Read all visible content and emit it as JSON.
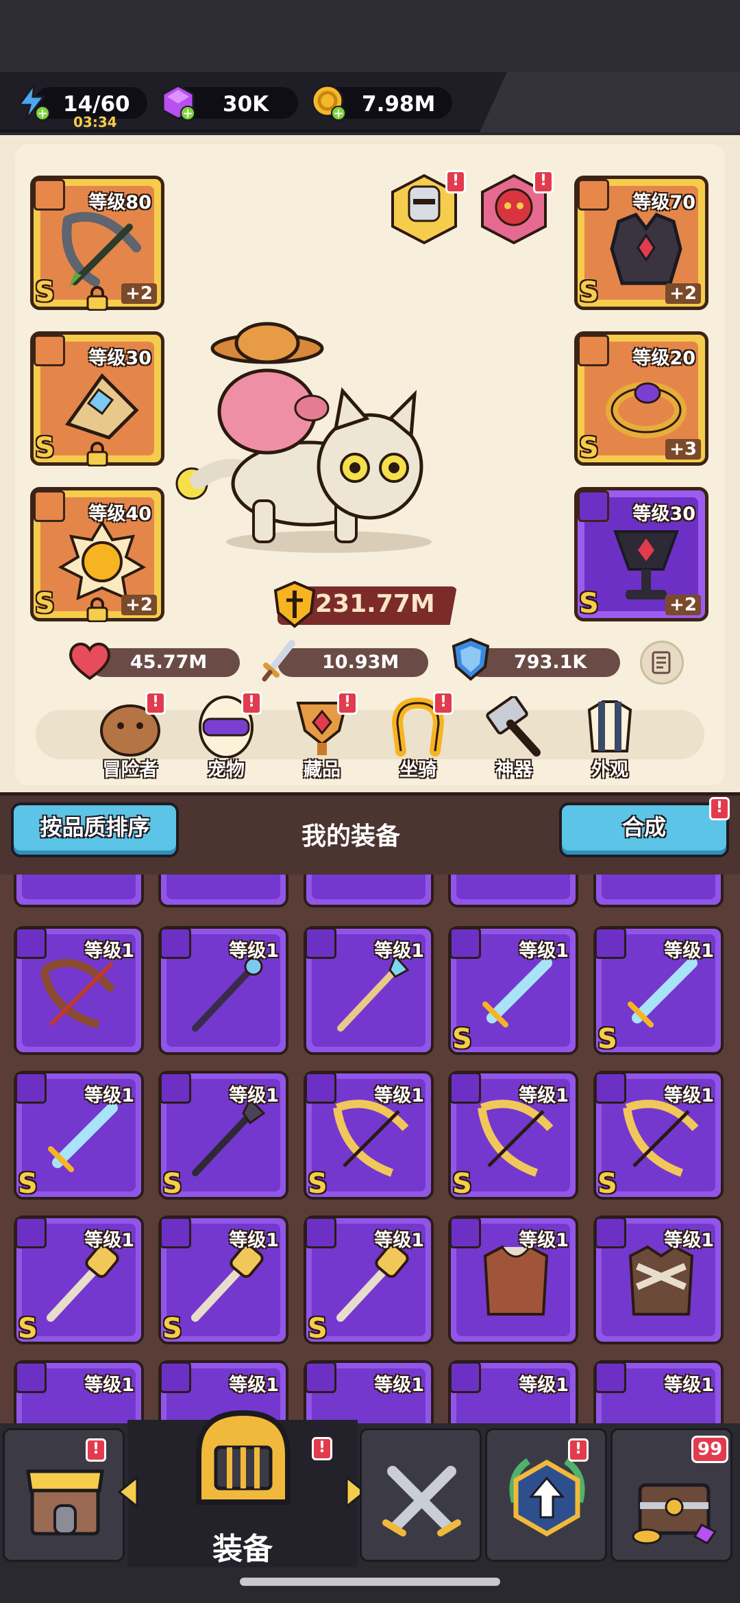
{
  "resources": {
    "energy": "14/60",
    "energy_timer": "03:34",
    "gems": "30K",
    "coins": "7.98M"
  },
  "equipment_slots": {
    "left": [
      {
        "level": "等级80",
        "plus": "+2",
        "grade": "S",
        "locked": true
      },
      {
        "level": "等级30",
        "plus": "",
        "grade": "S",
        "locked": true
      },
      {
        "level": "等级40",
        "plus": "+2",
        "grade": "S",
        "locked": true
      }
    ],
    "right": [
      {
        "level": "等级70",
        "plus": "+2",
        "grade": "S",
        "locked": false
      },
      {
        "level": "等级20",
        "plus": "+3",
        "grade": "S",
        "locked": false
      },
      {
        "level": "等级30",
        "plus": "+2",
        "grade": "S",
        "locked": false
      }
    ]
  },
  "power": "231.77M",
  "stats": {
    "hp": "45.77M",
    "attack": "10.93M",
    "defense": "793.1K"
  },
  "menu": [
    "冒险者",
    "宠物",
    "藏品",
    "坐骑",
    "神器",
    "外观"
  ],
  "equipment_header": {
    "sort_button": "按品质排序",
    "title": "我的装备",
    "merge_button": "合成"
  },
  "inventory": {
    "rows": [
      [
        {
          "level": "等级1",
          "grade": ""
        },
        {
          "level": "等级1",
          "grade": ""
        },
        {
          "level": "等级1",
          "grade": ""
        },
        {
          "level": "等级1",
          "grade": "S"
        },
        {
          "level": "等级1",
          "grade": "S"
        }
      ],
      [
        {
          "level": "等级1",
          "grade": "S"
        },
        {
          "level": "等级1",
          "grade": "S"
        },
        {
          "level": "等级1",
          "grade": "S"
        },
        {
          "level": "等级1",
          "grade": "S"
        },
        {
          "level": "等级1",
          "grade": "S"
        }
      ],
      [
        {
          "level": "等级1",
          "grade": "S"
        },
        {
          "level": "等级1",
          "grade": "S"
        },
        {
          "level": "等级1",
          "grade": "S"
        },
        {
          "level": "等级1",
          "grade": ""
        },
        {
          "level": "等级1",
          "grade": ""
        }
      ],
      [
        {
          "level": "等级1",
          "grade": ""
        },
        {
          "level": "等级1",
          "grade": ""
        },
        {
          "level": "等级1",
          "grade": ""
        },
        {
          "level": "等级1",
          "grade": ""
        },
        {
          "level": "等级1",
          "grade": ""
        }
      ]
    ]
  },
  "nav": {
    "active_label": "装备",
    "chest_count": "99"
  },
  "colors": {
    "gold_frame": "#f6cc4c",
    "purple_frame": "#9d5cf0",
    "alert_red": "#e23b4d",
    "cyan_button": "#5cc4e6"
  }
}
